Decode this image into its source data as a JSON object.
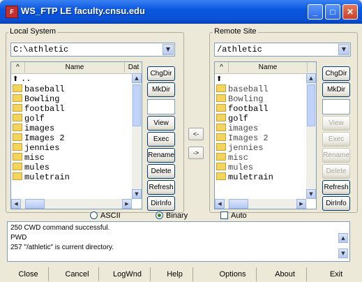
{
  "window": {
    "title": "WS_FTP LE faculty.cnsu.edu",
    "app_icon": "ftp-app-icon"
  },
  "local": {
    "label": "Local System",
    "path": "C:\\athletic",
    "columns": [
      "^",
      "Name",
      "Dat"
    ],
    "items": [
      {
        "name": "..",
        "type": "up"
      },
      {
        "name": "baseball",
        "type": "folder"
      },
      {
        "name": "Bowling",
        "type": "folder"
      },
      {
        "name": "football",
        "type": "folder"
      },
      {
        "name": "golf",
        "type": "folder"
      },
      {
        "name": "images",
        "type": "folder"
      },
      {
        "name": "Images 2",
        "type": "folder"
      },
      {
        "name": "jennies",
        "type": "folder"
      },
      {
        "name": "misc",
        "type": "folder"
      },
      {
        "name": "mules",
        "type": "folder"
      },
      {
        "name": "muletrain",
        "type": "folder"
      }
    ],
    "buttons": [
      "ChgDir",
      "MkDir",
      "View",
      "Exec",
      "Rename",
      "Delete",
      "Refresh",
      "DirInfo"
    ]
  },
  "transfer": {
    "left": "<-",
    "right": "->"
  },
  "remote": {
    "label": "Remote Site",
    "path": "/athletic",
    "columns": [
      "^",
      "Name"
    ],
    "items": [
      {
        "name": "",
        "type": "up"
      },
      {
        "name": "baseball",
        "type": "folder"
      },
      {
        "name": "Bowling",
        "type": "folder"
      },
      {
        "name": "football",
        "type": "folder"
      },
      {
        "name": "golf",
        "type": "folder"
      },
      {
        "name": "images",
        "type": "folder"
      },
      {
        "name": "Images 2",
        "type": "folder"
      },
      {
        "name": "jennies",
        "type": "folder"
      },
      {
        "name": "misc",
        "type": "folder"
      },
      {
        "name": "mules",
        "type": "folder"
      },
      {
        "name": "muletrain",
        "type": "folder"
      }
    ],
    "buttons": [
      "ChgDir",
      "MkDir",
      "View",
      "Exec",
      "Rename",
      "Delete",
      "Refresh",
      "DirInfo"
    ]
  },
  "mode": {
    "ascii": "ASCII",
    "binary": "Binary",
    "auto": "Auto",
    "selected": "Binary"
  },
  "log": [
    "250 CWD command successful.",
    "PWD",
    "257 \"/athletic\" is current directory."
  ],
  "bottom": [
    "Close",
    "Cancel",
    "LogWnd",
    "Help",
    "Options",
    "About",
    "Exit"
  ]
}
